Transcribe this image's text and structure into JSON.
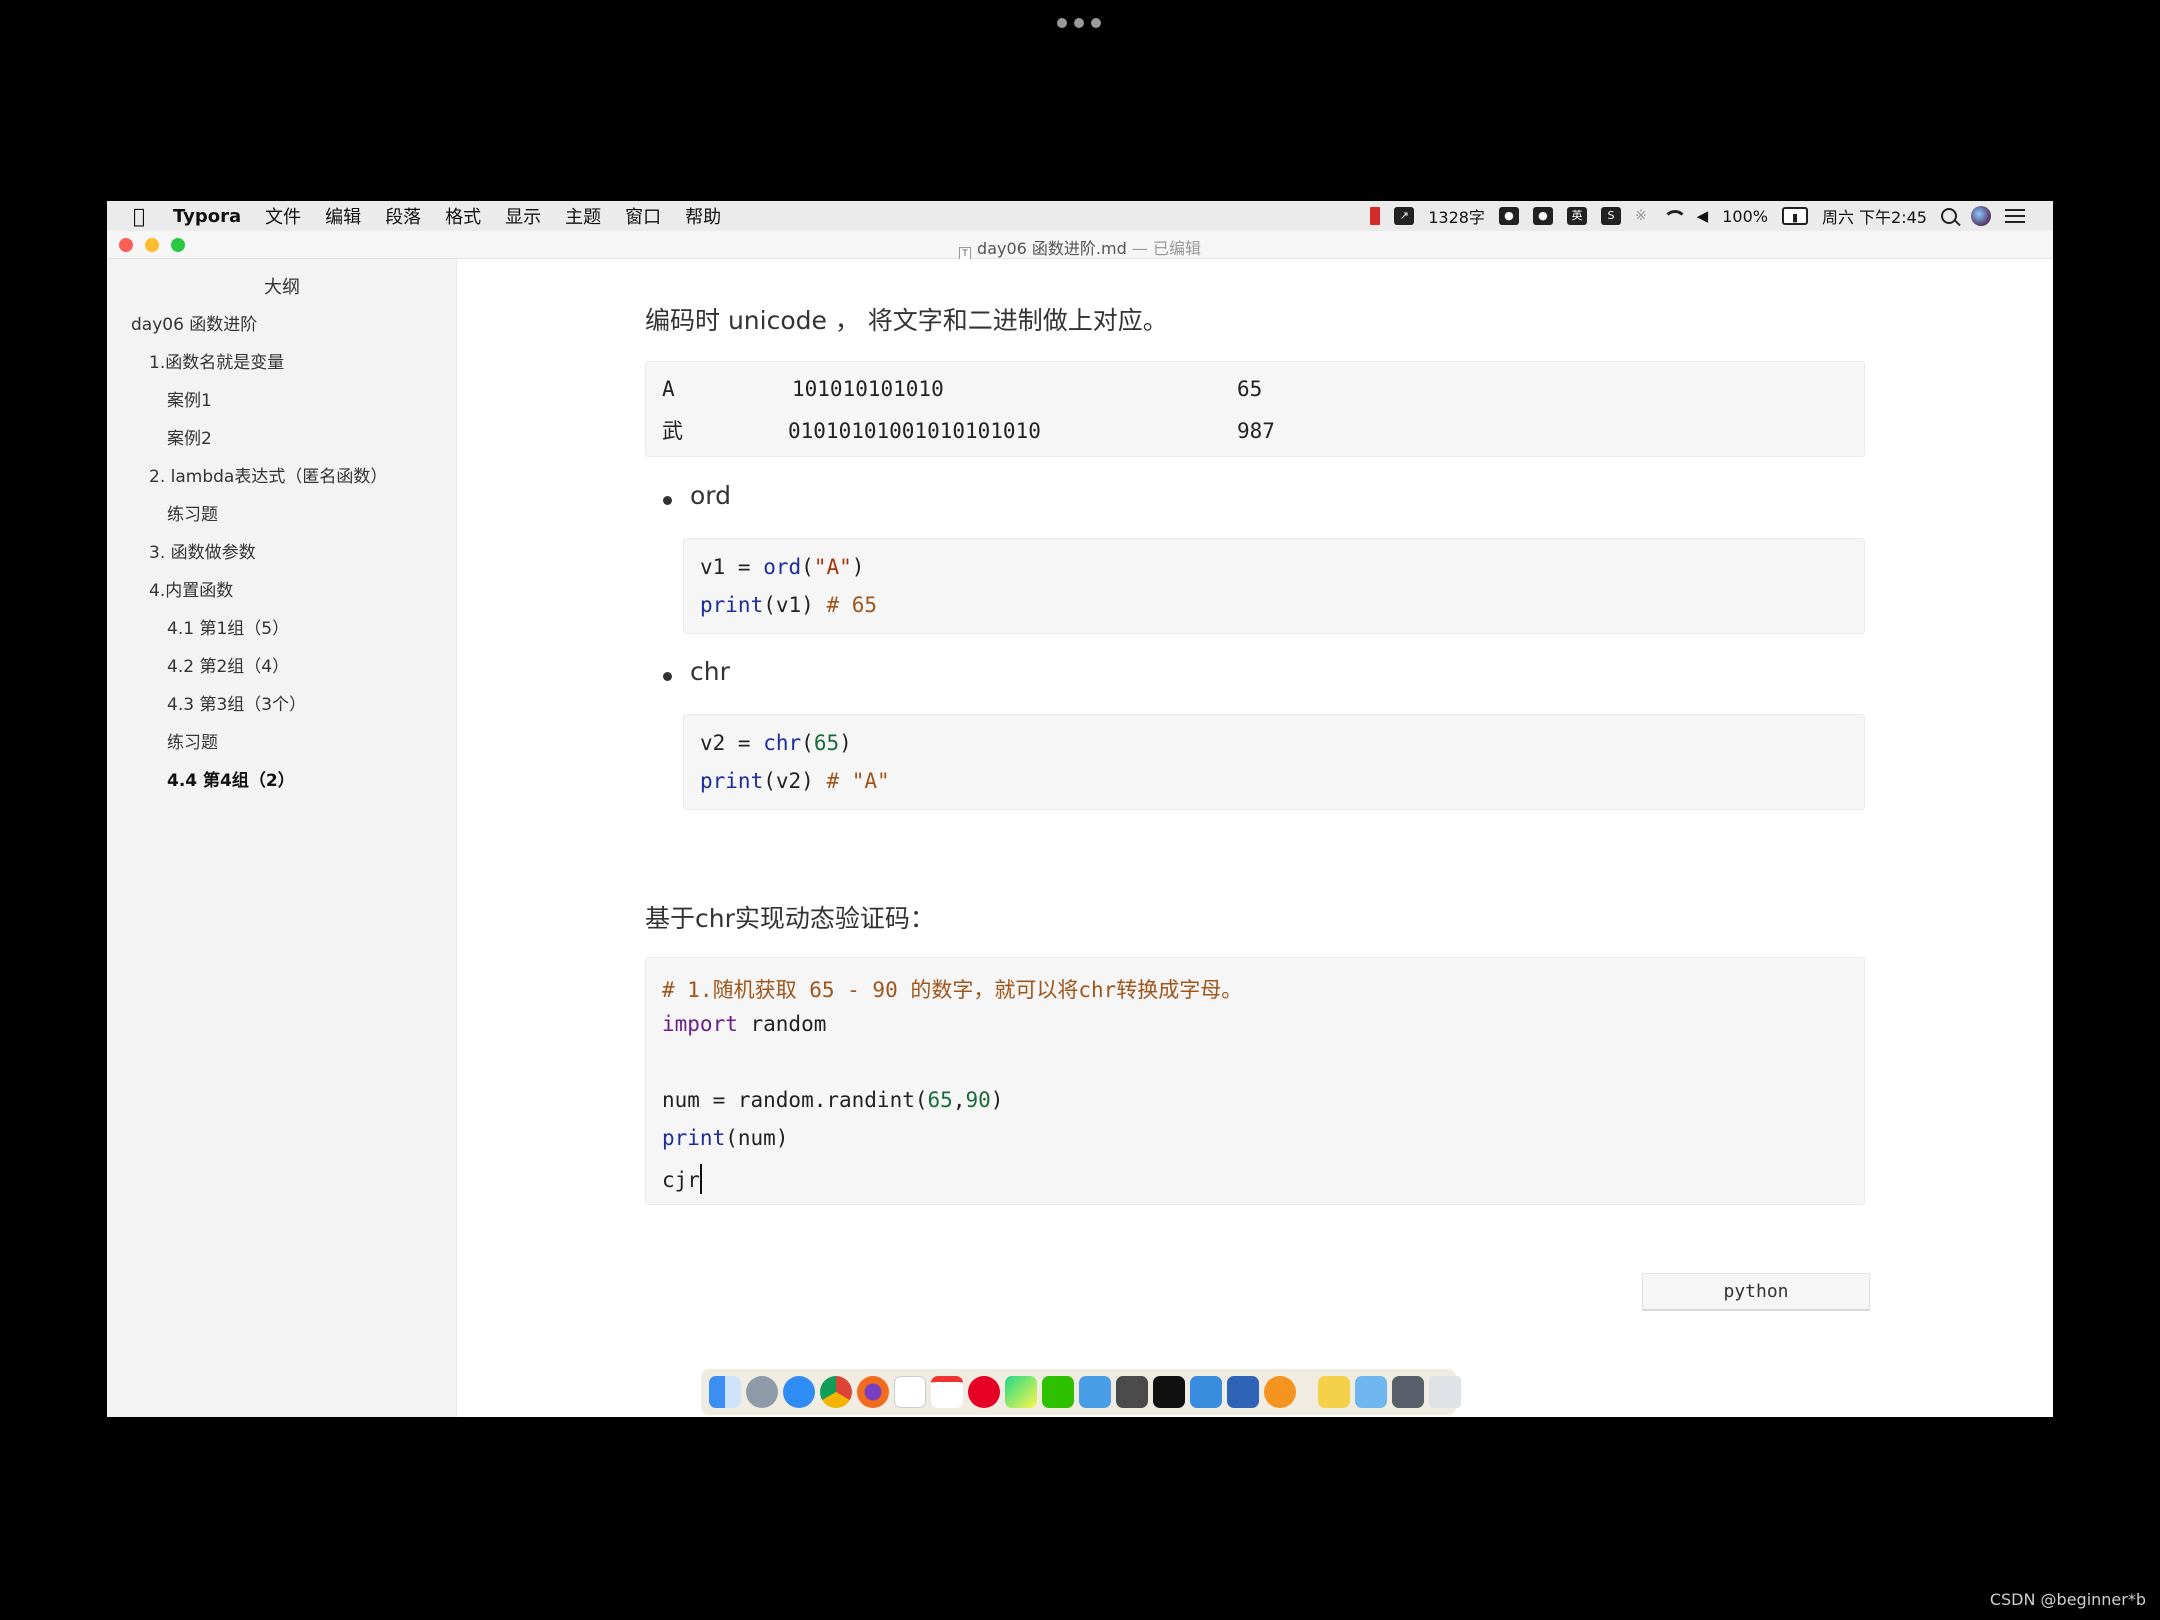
{
  "menubar": {
    "app_name": "Typora",
    "menus": [
      "文件",
      "编辑",
      "段落",
      "格式",
      "显示",
      "主题",
      "窗口",
      "帮助"
    ],
    "word_count": "1328字",
    "battery": "100%",
    "clock": "周六 下午2:45"
  },
  "window": {
    "title": "day06 函数进阶.md",
    "status": "— 已编辑"
  },
  "sidebar": {
    "title": "大纲",
    "items": [
      {
        "label": "day06 函数进阶"
      },
      {
        "label": "1.函数名就是变量"
      },
      {
        "label": "案例1"
      },
      {
        "label": "案例2"
      },
      {
        "label": "2. lambda表达式（匿名函数）"
      },
      {
        "label": "练习题"
      },
      {
        "label": "3. 函数做参数"
      },
      {
        "label": "4.内置函数"
      },
      {
        "label": "4.1 第1组（5）"
      },
      {
        "label": "4.2 第2组（4）"
      },
      {
        "label": "4.3 第3组（3个）"
      },
      {
        "label": "练习题"
      },
      {
        "label": "4.4 第4组（2）"
      }
    ],
    "active_index": 12
  },
  "editor": {
    "intro_text": "编码时 unicode ， 将文字和二进制做上对应。",
    "encoding_table": [
      {
        "char": "A",
        "binary": "101010101010",
        "code": "65"
      },
      {
        "char": "武",
        "binary": "01010101001010101010",
        "code": "987"
      }
    ],
    "bullet_ord": "ord",
    "ord_code": {
      "line1": {
        "var": "v1 = ",
        "func": "ord",
        "open": "(",
        "str": "\"A\"",
        "close": ")"
      },
      "line2": {
        "func": "print",
        "args": "(v1) ",
        "comment": "# 65"
      }
    },
    "bullet_chr": "chr",
    "chr_code": {
      "line1": {
        "var": "v2 = ",
        "func": "chr",
        "open": "(",
        "num": "65",
        "close": ")"
      },
      "line2": {
        "func": "print",
        "args": "(v2) ",
        "comment": "# \"A\""
      }
    },
    "captcha_heading": "基于chr实现动态验证码：",
    "captcha_code": {
      "comment": "# 1.随机获取 65 - 90 的数字，就可以将chr转换成字母。",
      "import_kw": "import",
      "import_mod": " random",
      "num_line_a": "num = random.randint(",
      "num_line_n1": "65",
      "num_line_sep": ",",
      "num_line_n2": "90",
      "num_line_b": ")",
      "print_kw": "print",
      "print_args": "(num)",
      "typing": "cjr"
    },
    "code_language": "python"
  },
  "watermark": "CSDN @beginner*b",
  "colors": {
    "code_bg": "#f6f6f6",
    "func": "#1d2d9c",
    "string": "#a8350c",
    "comment": "#a0551a",
    "keyword": "#6b1f8a"
  }
}
